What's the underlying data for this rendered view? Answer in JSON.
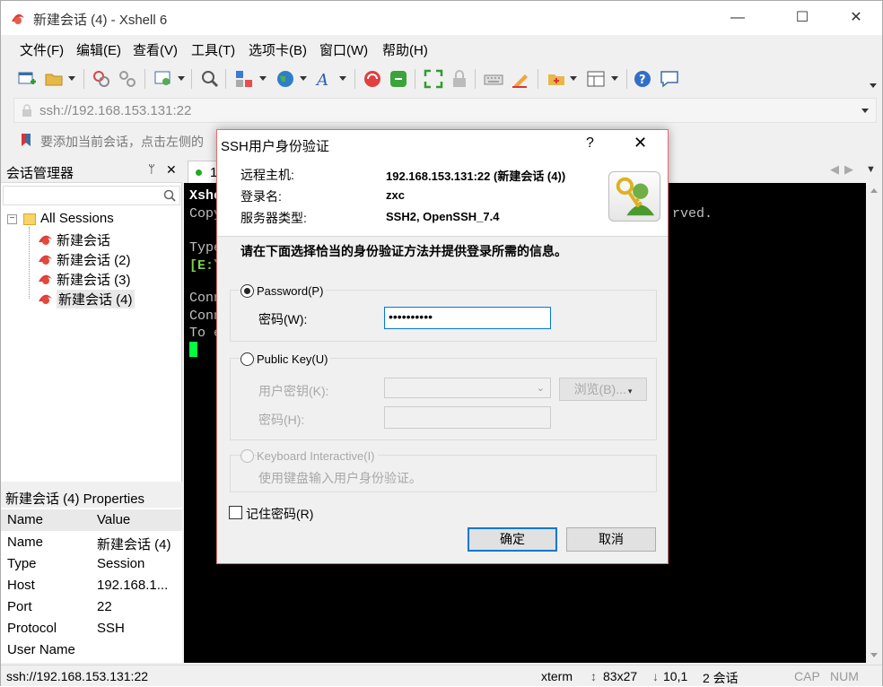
{
  "window": {
    "title": "新建会话 (4) - Xshell 6",
    "minimize_glyph": "—",
    "maximize_glyph": "☐",
    "close_glyph": "✕"
  },
  "menu": [
    "文件(F)",
    "编辑(E)",
    "查看(V)",
    "工具(T)",
    "选项卡(B)",
    "窗口(W)",
    "帮助(H)"
  ],
  "toolbar_icons": [
    "new-session-icon",
    "open-folder-icon",
    "reconnect-icon",
    "disconnect-icon",
    "properties-icon",
    "find-icon",
    "transfer-icon",
    "globe-icon",
    "font-icon",
    "xshell-icon",
    "xftp-icon",
    "fullscreen-icon",
    "lock-icon",
    "keyboard-icon",
    "highlight-icon",
    "compose-icon",
    "layout-icon",
    "help-icon",
    "chat-icon"
  ],
  "address": {
    "value": "ssh://192.168.153.131:22"
  },
  "hint": {
    "text": "要添加当前会话，点击左侧的"
  },
  "session_manager": {
    "title": "会话管理器",
    "pin_glyph": "ᛘ",
    "close_glyph": "✕",
    "root": {
      "label": "All Sessions",
      "expander": "−"
    },
    "sessions": [
      "新建会话",
      "新建会话 (2)",
      "新建会话 (3)",
      "新建会话 (4)"
    ]
  },
  "properties": {
    "title": "新建会话 (4) Properties",
    "col_name": "Name",
    "col_value": "Value",
    "rows": [
      {
        "k": "Name",
        "v": "新建会话 (4)"
      },
      {
        "k": "Type",
        "v": "Session"
      },
      {
        "k": "Host",
        "v": "192.168.1..."
      },
      {
        "k": "Port",
        "v": "22"
      },
      {
        "k": "Protocol",
        "v": "SSH"
      },
      {
        "k": "User Name",
        "v": ""
      }
    ]
  },
  "tab": {
    "label": "1",
    "prev": "◀",
    "next": "▶",
    "menu": "▼"
  },
  "terminal": {
    "lines": [
      "Xshe",
      "Copy",
      "",
      "Type",
      "[E:\\",
      "",
      "Conn",
      "Conn",
      "To e"
    ],
    "right_fragment": "rved."
  },
  "status": {
    "address": "ssh://192.168.153.131:22",
    "term": "xterm",
    "size": "83x27",
    "pos": "10,1",
    "sessions": "2 会话",
    "cap": "CAP",
    "num": "NUM"
  },
  "dialog": {
    "title": "SSH用户身份验证",
    "help_glyph": "?",
    "close_glyph": "✕",
    "remote_host_label": "远程主机:",
    "remote_host_value": "192.168.153.131:22 (新建会话 (4))",
    "login_label": "登录名:",
    "login_value": "zxc",
    "server_type_label": "服务器类型:",
    "server_type_value": "SSH2, OpenSSH_7.4",
    "prompt": "请在下面选择恰当的身份验证方法并提供登录所需的信息。",
    "password_option": "Password(P)",
    "password_label": "密码(W):",
    "password_value": "••••••••••",
    "pubkey_option": "Public Key(U)",
    "user_key_label": "用户密钥(K):",
    "browse_label": "浏览(B)...",
    "passphrase_label": "密码(H):",
    "keyboard_option": "Keyboard Interactive(I)",
    "keyboard_desc": "使用键盘输入用户身份验证。",
    "remember_label": "记住密码(R)",
    "ok_label": "确定",
    "cancel_label": "取消"
  },
  "colors": {
    "accent": "#0078d7",
    "terminal_bg": "#000000",
    "cursor": "#00ff40",
    "dialog_border": "#e07070"
  }
}
